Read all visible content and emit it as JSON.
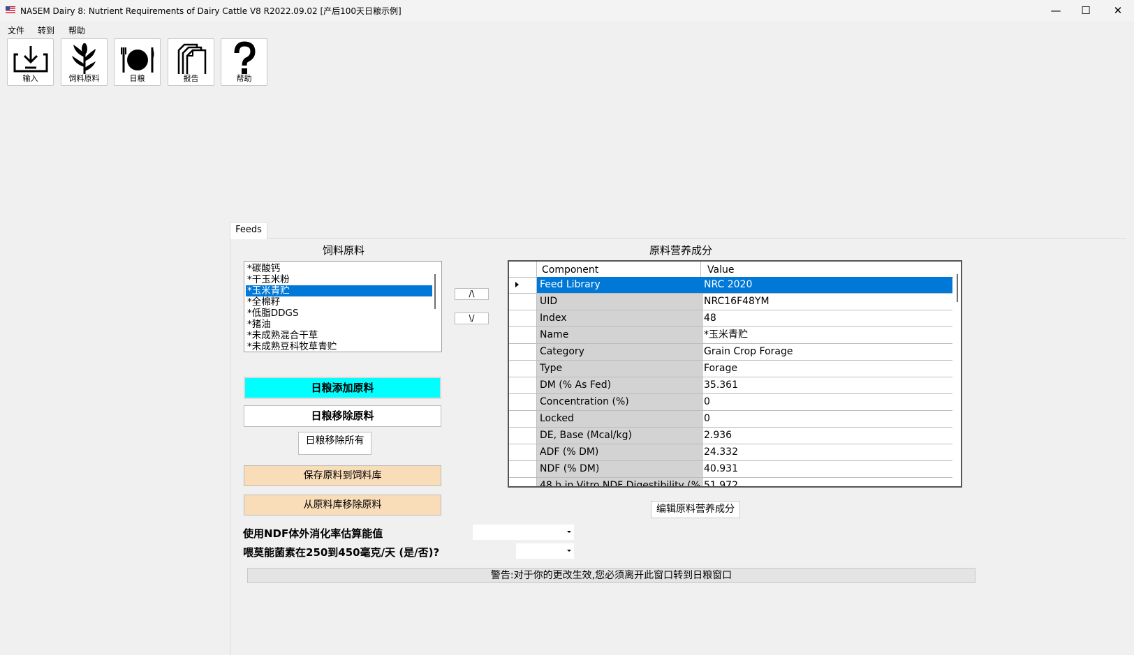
{
  "window": {
    "title": "NASEM Dairy 8: Nutrient Requirements of Dairy Cattle  V8 R2022.09.02 [产后100天日粮示例]",
    "minimize": "—",
    "maximize": "☐",
    "close": "✕"
  },
  "menu": [
    {
      "label": "文件"
    },
    {
      "label": "转到"
    },
    {
      "label": "帮助"
    }
  ],
  "toolbar": [
    {
      "label": "输入",
      "icon": "download-tray-icon"
    },
    {
      "label": "饲料原料",
      "icon": "corn-plant-icon"
    },
    {
      "label": "日粮",
      "icon": "plate-cutlery-icon"
    },
    {
      "label": "报告",
      "icon": "documents-icon"
    },
    {
      "label": "帮助",
      "icon": "question-mark-icon"
    }
  ],
  "tab": {
    "label": "Feeds"
  },
  "feeds_section": {
    "title": "饲料原料",
    "items": [
      "*碳酸钙",
      "*干玉米粉",
      "*玉米青贮",
      "*全棉籽",
      "*低脂DDGS",
      "*猪油",
      "*未成熟混合干草",
      "*未成熟豆科牧草青贮"
    ],
    "selected_index": 2,
    "move_up": "/\\",
    "move_down": "\\/"
  },
  "buttons": {
    "add_to_ration": "日粮添加原料",
    "remove_from_ration": "日粮移除原料",
    "remove_all": "日粮移除所有",
    "save_to_library": "保存原料到饲料库",
    "remove_from_library": "从原料库移除原料",
    "edit_nutrients": "编辑原料营养成分"
  },
  "nutrient_section": {
    "title": "原料营养成分",
    "columns": [
      "Component",
      "Value"
    ],
    "rows": [
      {
        "component": "Feed Library",
        "value": "NRC 2020"
      },
      {
        "component": "UID",
        "value": "NRC16F48YM"
      },
      {
        "component": "Index",
        "value": "48"
      },
      {
        "component": "Name",
        "value": "*玉米青贮"
      },
      {
        "component": "Category",
        "value": "Grain Crop Forage"
      },
      {
        "component": "Type",
        "value": "Forage"
      },
      {
        "component": "DM (% As Fed)",
        "value": "35.361"
      },
      {
        "component": "Concentration (%)",
        "value": "0"
      },
      {
        "component": "Locked",
        "value": "0"
      },
      {
        "component": "DE, Base (Mcal/kg)",
        "value": "2.936"
      },
      {
        "component": "ADF (% DM)",
        "value": "24.332"
      },
      {
        "component": "NDF (% DM)",
        "value": "40.931"
      },
      {
        "component": "48 h in Vitro NDF Digestibility (%",
        "value": "51.972"
      }
    ],
    "selected_index": 0
  },
  "form": {
    "ndf_label": "使用NDF体外消化率估算能值",
    "ndf_value": "",
    "monensin_label": "喂莫能菌素在250到450毫克/天 (是/否)?",
    "monensin_value": ""
  },
  "warning": "警告:对于你的更改生效,您必须离开此窗口转到日粮窗口",
  "colors": {
    "selection": "#0078d7",
    "add_button": "#00ffff",
    "library_buttons": "#f9dcb8",
    "grid_label_cell": "#d3d3d3"
  }
}
